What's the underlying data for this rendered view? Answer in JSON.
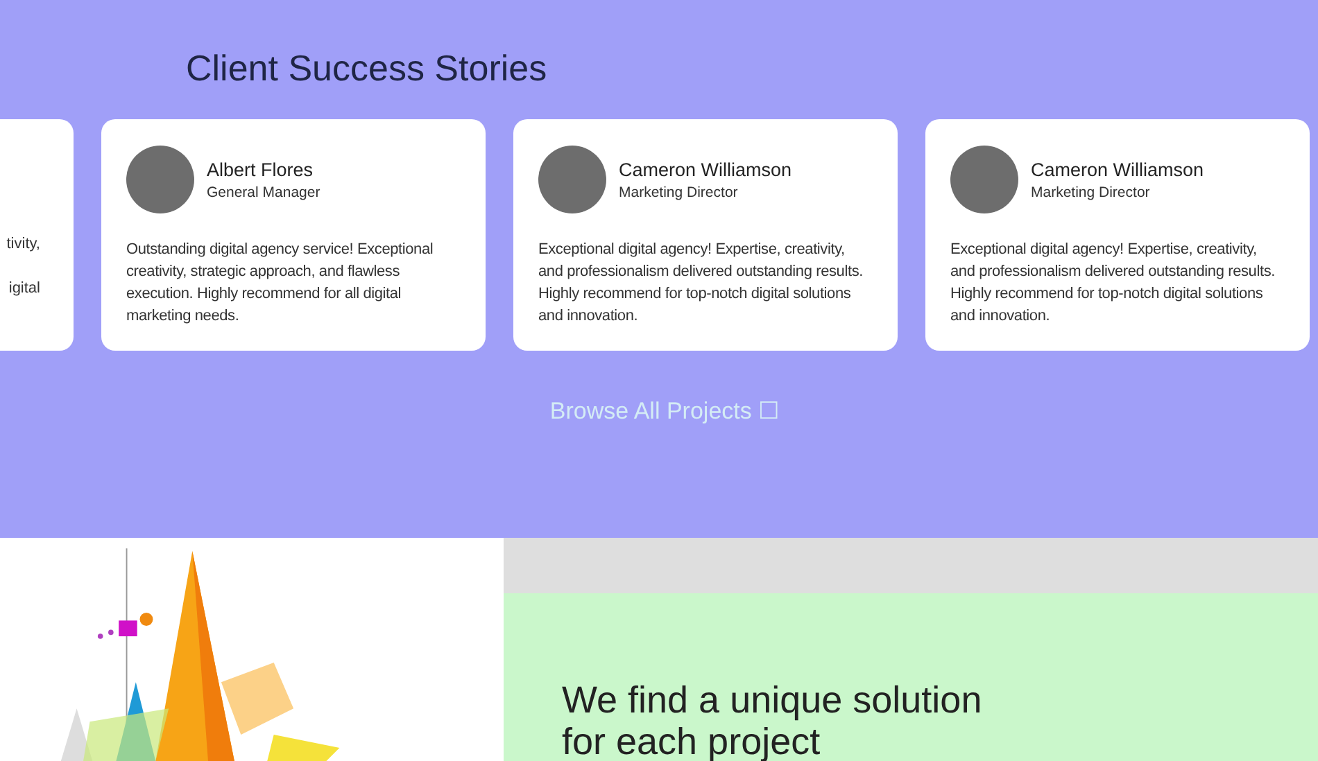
{
  "testimonials": {
    "title": "Client Success Stories",
    "partial_card": {
      "lines": [
        "tivity,",
        "igital"
      ]
    },
    "cards": [
      {
        "name": "Albert Flores",
        "role": "General Manager",
        "quote": "Outstanding digital agency service! Exceptional creativity, strategic approach, and flawless execution. Highly recommend for all digital marketing needs."
      },
      {
        "name": "Cameron Williamson",
        "role": "Marketing Director",
        "quote": "Exceptional digital agency! Expertise, creativity, and professionalism delivered outstanding results. Highly recommend for top-notch digital solutions and innovation."
      },
      {
        "name": "Cameron Williamson",
        "role": "Marketing Director",
        "quote": "Exceptional digital agency! Expertise, creativity, and professionalism delivered outstanding results. Highly recommend for top-notch digital solutions and innovation."
      }
    ],
    "link": "Browse All Projects ☐"
  },
  "solution": {
    "heading": "We find a unique solution for each project"
  }
}
